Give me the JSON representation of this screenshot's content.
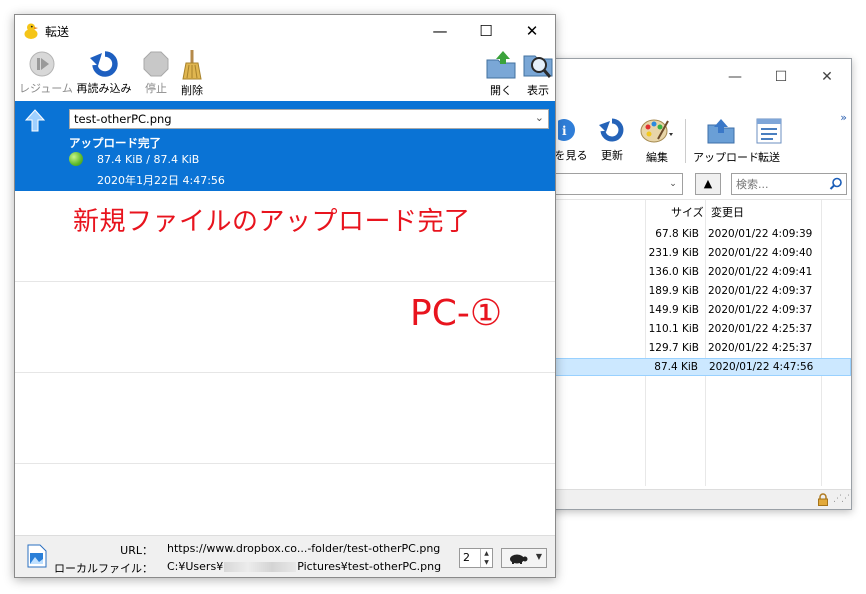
{
  "back_window": {
    "controls": {
      "minimize": "—",
      "maximize": "☐",
      "close": "✕"
    },
    "chevron": "»",
    "toolbar": {
      "view_partial": "を見る",
      "refresh": "更新",
      "edit": "編集",
      "upload": "アップロード",
      "transfer": "転送"
    },
    "up_button": "▲",
    "search_placeholder": "検索...",
    "columns": {
      "size": "サイズ",
      "modified": "変更日"
    },
    "rows": [
      {
        "size": "67.8 KiB",
        "date": "2020/01/22 4:09:39"
      },
      {
        "size": "231.9 KiB",
        "date": "2020/01/22 4:09:40"
      },
      {
        "size": "136.0 KiB",
        "date": "2020/01/22 4:09:41"
      },
      {
        "size": "189.9 KiB",
        "date": "2020/01/22 4:09:37"
      },
      {
        "size": "149.9 KiB",
        "date": "2020/01/22 4:09:37"
      },
      {
        "size": "110.1 KiB",
        "date": "2020/01/22 4:25:37"
      },
      {
        "size": "129.7 KiB",
        "date": "2020/01/22 4:25:37"
      },
      {
        "size": "87.4 KiB",
        "date": "2020/01/22 4:47:56"
      }
    ],
    "grip": "⋰⋰"
  },
  "main_window": {
    "title": "転送",
    "controls": {
      "minimize": "—",
      "maximize": "☐",
      "close": "✕"
    },
    "toolbar": {
      "resume": "レジューム",
      "reload": "再読み込み",
      "stop": "停止",
      "delete": "削除",
      "open": "開く",
      "display": "表示"
    },
    "transfer": {
      "file_name": "test-otherPC.png",
      "status": "アップロード完了",
      "size": "87.4 KiB / 87.4 KiB",
      "datetime": "2020年1月22日 4:47:56"
    },
    "annotations": {
      "note": "新規ファイルのアップロード完了",
      "pc_label": "PC-①"
    },
    "bottom": {
      "url_label": "URL：",
      "url_value": "https://www.dropbox.co...-folder/test-otherPC.png",
      "local_label": "ローカルファイル：",
      "local_prefix": "C:¥Users¥",
      "local_suffix": "Pictures¥test-otherPC.png",
      "spinner_value": "2"
    }
  },
  "colors": {
    "accent_blue": "#0a73d5",
    "annotation_red": "#e8141e",
    "selection": "#cce8ff"
  }
}
